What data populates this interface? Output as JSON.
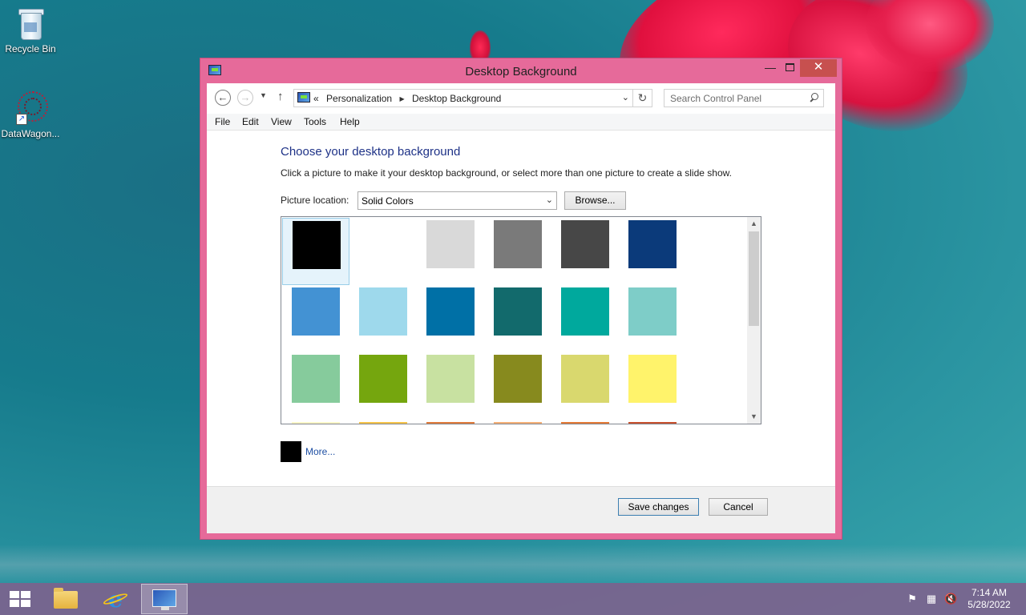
{
  "desktop": {
    "icons": [
      {
        "label": "Recycle Bin"
      },
      {
        "label": "DataWagon..."
      }
    ]
  },
  "window": {
    "title": "Desktop Background",
    "controls": {
      "minimize": "—",
      "close": "✕"
    },
    "nav": {
      "back": "←",
      "forward": "→",
      "breadcrumb_prefix": "«",
      "breadcrumb": [
        "Personalization",
        "Desktop Background"
      ],
      "search_placeholder": "Search Control Panel"
    },
    "menu": [
      "File",
      "Edit",
      "View",
      "Tools",
      "Help"
    ],
    "heading": "Choose your desktop background",
    "description": "Click a picture to make it your desktop background, or select more than one picture to create a slide show.",
    "picture_location_label": "Picture location:",
    "picture_location_value": "Solid Colors",
    "browse_label": "Browse...",
    "swatches": [
      [
        "#000000",
        "#ffffff",
        "#d9d9d9",
        "#7a7a7a",
        "#474747",
        "#0b3a7a"
      ],
      [
        "#4392d3",
        "#9ed9ec",
        "#0070a6",
        "#126a6c",
        "#00a99d",
        "#7ecdc8"
      ],
      [
        "#86cb9c",
        "#75a60e",
        "#c8e1a1",
        "#878a1e",
        "#d9d86e",
        "#fff36b"
      ],
      [
        "#fff7c8",
        "#f6c44a",
        "#e07b3b",
        "#f5b076",
        "#e47a36",
        "#c8502d"
      ]
    ],
    "selected_swatch": 0,
    "more_label": "More...",
    "save_label": "Save changes",
    "cancel_label": "Cancel"
  },
  "taskbar": {
    "time": "7:14 AM",
    "date": "5/28/2022",
    "active_app": "control-panel"
  }
}
